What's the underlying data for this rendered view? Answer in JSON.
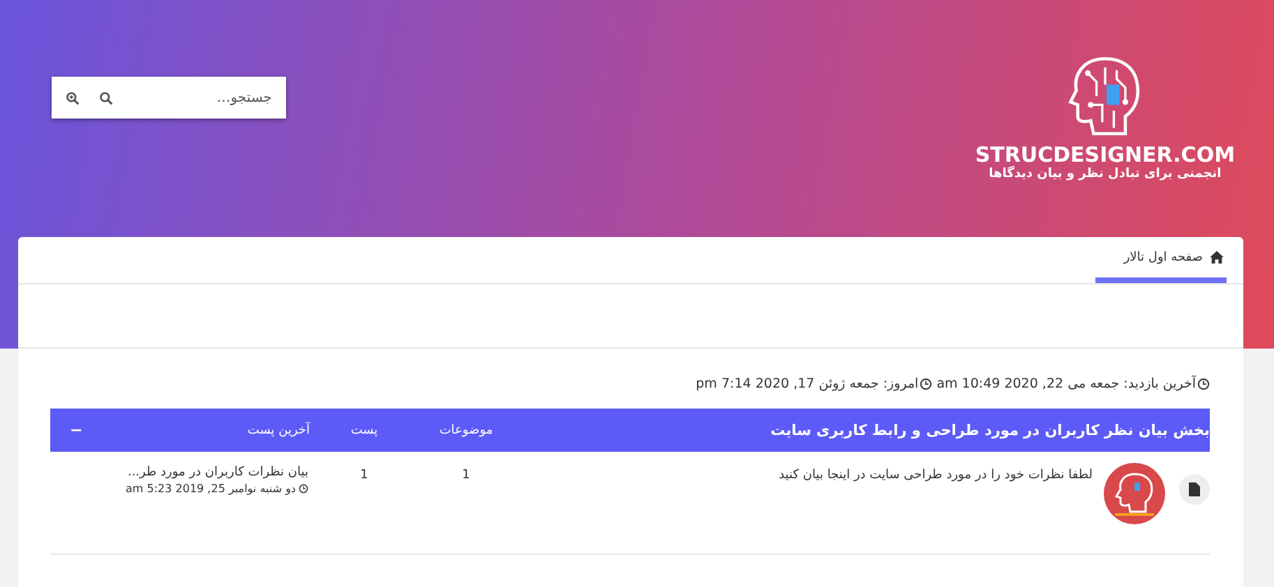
{
  "header": {
    "search": {
      "placeholder": "جستجو…"
    },
    "logo": {
      "title": "STRUCDESIGNER.COM",
      "tagline": "انجمنی برای تبادل نظر و بیان دیدگاها"
    }
  },
  "nav": {
    "tabs": [
      {
        "label": "صفحه اول تالار",
        "selected": true
      }
    ]
  },
  "visits": [
    {
      "label": "آخرین بازدید: جمعه می 22, 2020 10:49 am"
    },
    {
      "label": "امروز: جمعه ژوئن 17, 2020 7:14 pm"
    }
  ],
  "forum": {
    "title": "بخش بیان نظر کاربران در مورد طراحی و رابط کاربری سایت",
    "collapse": "−",
    "columns": [
      "موضوعات",
      "پست",
      "آخرین پست"
    ],
    "rows": [
      {
        "description": "لطفا نظرات خود را در مورد طراحی سایت در اینجا بیان کنید",
        "topics": "1",
        "posts": "1",
        "last_post": {
          "title": "بیان نظرات کاربران در مورد طر...",
          "time": "دو شنبه نوامبر 25, 2019 5:23 am"
        }
      }
    ]
  }
}
